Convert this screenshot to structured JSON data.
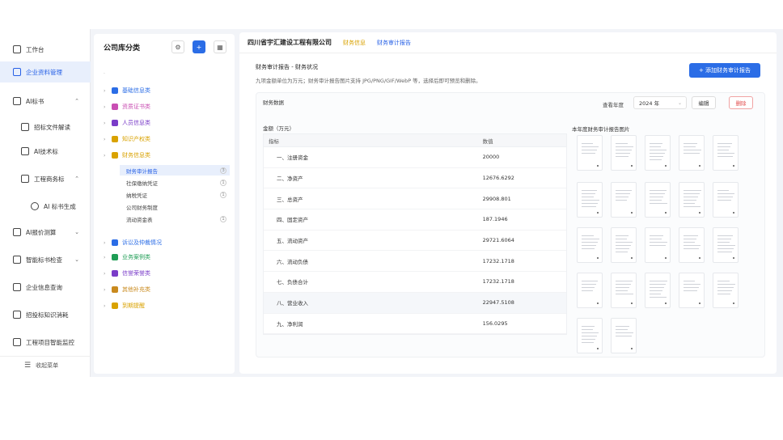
{
  "nav": {
    "items": [
      {
        "label": "工作台",
        "icon": "monitor-icon"
      },
      {
        "label": "企业资料管理",
        "icon": "building-icon",
        "active": true
      },
      {
        "label": "AI标书",
        "icon": "book-icon",
        "chev": "⌃"
      },
      {
        "label": "招标文件解读",
        "icon": "file-icon"
      },
      {
        "label": "AI技术标",
        "icon": "doc-icon"
      },
      {
        "label": "工程商务标",
        "icon": "folder-icon",
        "chev": "⌃"
      },
      {
        "label": "AI 标书生成",
        "icon": "pen-icon"
      },
      {
        "label": "AI报价测算",
        "icon": "calc-icon",
        "chev": "⌄"
      },
      {
        "label": "智能标书检查",
        "icon": "filter-icon",
        "chev": "⌄"
      },
      {
        "label": "企业信息查询",
        "icon": "search-icon"
      },
      {
        "label": "招投标知识消耗",
        "icon": "chat-icon"
      },
      {
        "label": "工程项目智能监控",
        "icon": "video-icon"
      }
    ],
    "collapse_label": "收起菜单"
  },
  "tree": {
    "title": "公司库分类",
    "search_placeholder": "·",
    "nodes": [
      {
        "label": "基础信息类",
        "color": "#2b6de6"
      },
      {
        "label": "资质证书类",
        "color": "#c94fb3"
      },
      {
        "label": "人员信息类",
        "color": "#7a3cc8"
      },
      {
        "label": "知识产权类",
        "color": "#d9a200"
      },
      {
        "label": "财务信息类",
        "color": "#d9a200"
      },
      {
        "label": "诉讼及仲裁情况",
        "color": "#2b6de6"
      },
      {
        "label": "业务案例类",
        "color": "#1f9d55"
      },
      {
        "label": "信誉荣誉类",
        "color": "#7a3cc8"
      },
      {
        "label": "其他补充类",
        "color": "#c98a1e"
      },
      {
        "label": "到期提醒",
        "color": "#d9a200"
      }
    ],
    "leaves": [
      {
        "label": "财务审计报告",
        "count": "3",
        "active": true
      },
      {
        "label": "社保缴纳凭证",
        "count": "1"
      },
      {
        "label": "纳税凭证",
        "count": "1"
      },
      {
        "label": "公司财务制度",
        "count": ""
      },
      {
        "label": "流动资金表",
        "count": "1"
      }
    ]
  },
  "main": {
    "company": "四川省宇汇建设工程有限公司",
    "tabs": [
      "财务信息",
      "财务审计报告"
    ],
    "section_title": "财务审计报告 - 财务状况",
    "section_desc": "九项金额单位为万元；财务审计报告图片支持 JPG/PNG/GIF/WebP 等，选择后即可预览和删除。",
    "add_button": "+ 添加财务审计报告",
    "card_title": "财务数据",
    "year_label": "查看年度",
    "year_value": "2024 年",
    "edit_label": "编辑",
    "delete_label": "删除",
    "unit_label": "金额（万元）",
    "table": {
      "headers": [
        "指标",
        "数值"
      ],
      "rows": [
        [
          "一、注册资金",
          "20000"
        ],
        [
          "二、净资产",
          "12676.6292"
        ],
        [
          "三、总资产",
          "29908.801"
        ],
        [
          "四、固定资产",
          "187.1946"
        ],
        [
          "五、流动资产",
          "29721.6064"
        ],
        [
          "六、流动负债",
          "17232.1718"
        ],
        [
          "七、负债合计",
          "17232.1718"
        ],
        [
          "八、营业收入",
          "22947.5108"
        ],
        [
          "九、净利润",
          "156.0295"
        ]
      ]
    },
    "images_title": "本年度财务审计报告图片"
  }
}
